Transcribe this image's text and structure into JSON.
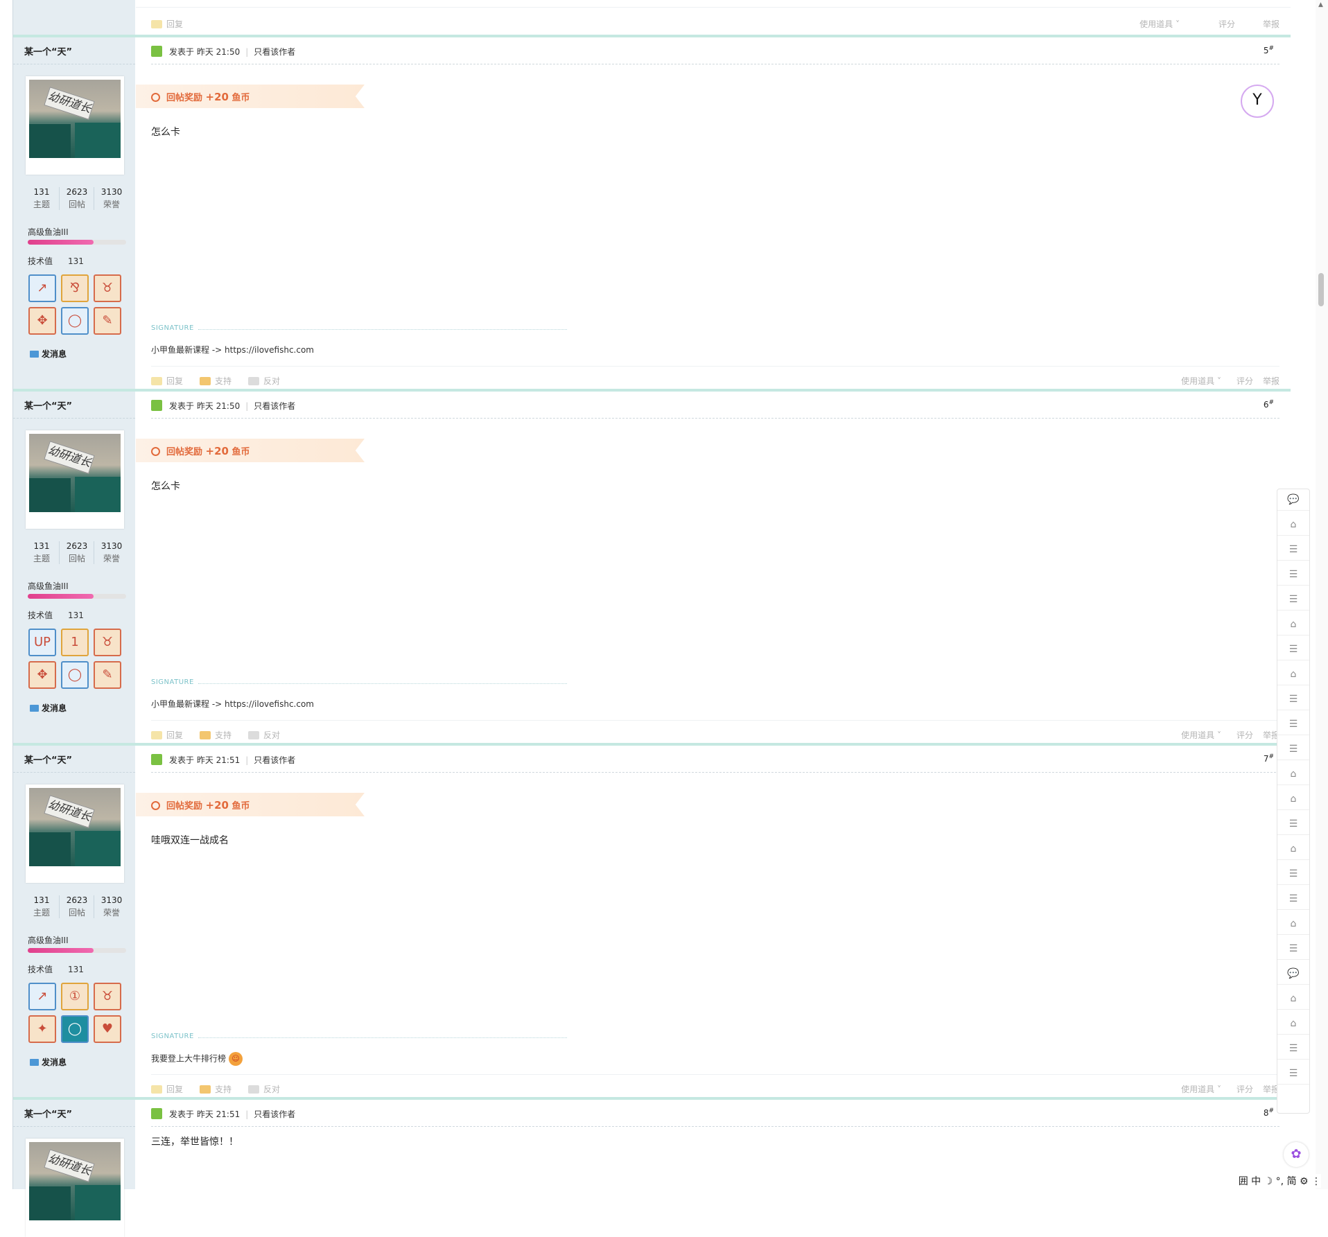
{
  "top_footer": {
    "reply": "回复",
    "use_tool": "使用道具",
    "rate": "评分",
    "report": "举报"
  },
  "posts": [
    {
      "author": "某一个“天”",
      "stats": [
        {
          "value": "131",
          "label": "主题"
        },
        {
          "value": "2623",
          "label": "回帖"
        },
        {
          "value": "3130",
          "label": "荣誉"
        }
      ],
      "rank": "高级鱼油III",
      "rank_progress": 0.67,
      "tech_label": "技术值",
      "tech_value": "131",
      "send_msg": "发消息",
      "time": "发表于 昨天 21:50",
      "only_author": "只看该作者",
      "floor": "5",
      "reward_label": "回帖奖励",
      "reward_amount": "+20",
      "reward_unit": "鱼币",
      "content": "怎么卡",
      "sig_label": "SIGNATURE",
      "signature": "小甲鱼最新课程 -> https://ilovefishc.com",
      "reply": "回复",
      "support": "支持",
      "oppose": "反对",
      "use_tool": "使用道具",
      "rate": "评分",
      "report": "举报"
    },
    {
      "author": "某一个“天”",
      "stats": [
        {
          "value": "131",
          "label": "主题"
        },
        {
          "value": "2623",
          "label": "回帖"
        },
        {
          "value": "3130",
          "label": "荣誉"
        }
      ],
      "rank": "高级鱼油III",
      "rank_progress": 0.67,
      "tech_label": "技术值",
      "tech_value": "131",
      "send_msg": "发消息",
      "time": "发表于 昨天 21:50",
      "only_author": "只看该作者",
      "floor": "6",
      "reward_label": "回帖奖励",
      "reward_amount": "+20",
      "reward_unit": "鱼币",
      "content": "怎么卡",
      "sig_label": "SIGNATURE",
      "signature": "小甲鱼最新课程 -> https://ilovefishc.com",
      "reply": "回复",
      "support": "支持",
      "oppose": "反对",
      "use_tool": "使用道具",
      "rate": "评分",
      "report": "举报"
    },
    {
      "author": "某一个“天”",
      "stats": [
        {
          "value": "131",
          "label": "主题"
        },
        {
          "value": "2623",
          "label": "回帖"
        },
        {
          "value": "3130",
          "label": "荣誉"
        }
      ],
      "rank": "高级鱼油III",
      "rank_progress": 0.67,
      "tech_label": "技术值",
      "tech_value": "131",
      "send_msg": "发消息",
      "time": "发表于 昨天 21:51",
      "only_author": "只看该作者",
      "floor": "7",
      "reward_label": "回帖奖励",
      "reward_amount": "+20",
      "reward_unit": "鱼币",
      "content": "哇哦双连一战成名",
      "sig_label": "SIGNATURE",
      "signature": "我要登上大牛排行榜",
      "reply": "回复",
      "support": "支持",
      "oppose": "反对",
      "use_tool": "使用道具",
      "rate": "评分",
      "report": "举报"
    },
    {
      "author": "某一个“天”",
      "time": "发表于 昨天 21:51",
      "only_author": "只看该作者",
      "floor": "8",
      "content": "三连，举世皆惊！！"
    }
  ],
  "icons": {
    "avatar_sign": "幼研道长",
    "post_logo": "Y",
    "brain": "brain-icon"
  },
  "ime_bar": "囲 中 ☽ °, 简 ⚙ ⋮",
  "colors": {
    "accent_teal": "#c5e8e1",
    "reward_orange": "#e26a3b",
    "rank_pink": "#e0408c",
    "sidebar_bg": "#e5edf2"
  }
}
